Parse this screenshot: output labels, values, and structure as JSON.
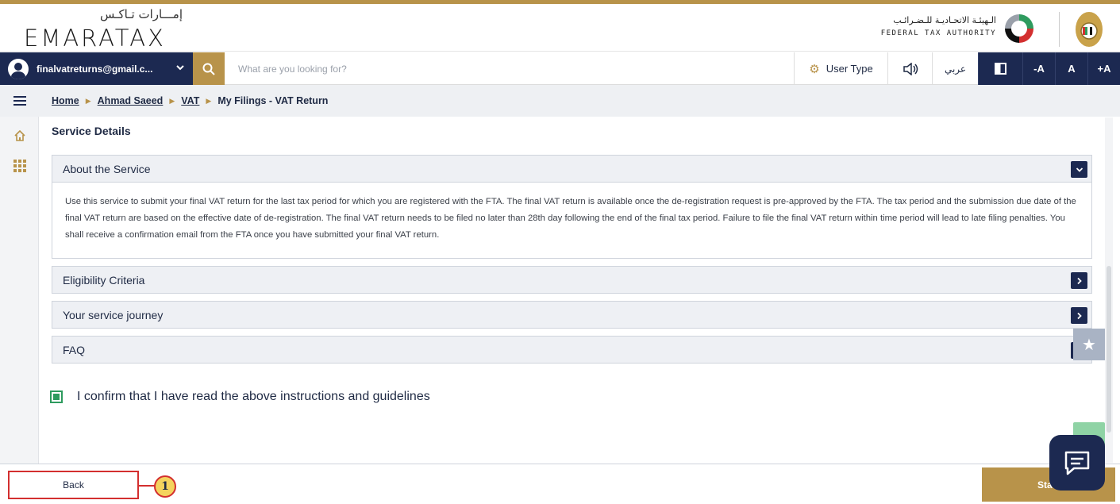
{
  "logo": {
    "ar": "إمـــارات تـاكـس",
    "en": "EMARATAX"
  },
  "authority": {
    "ar": "الـهيئـة الاتحـاديـة للـضـرائـب",
    "en": "FEDERAL TAX AUTHORITY"
  },
  "nav": {
    "user_email": "finalvatreturns@gmail.c...",
    "search_placeholder": "What are you looking for?",
    "user_type": "User Type",
    "language": "عربي",
    "font_decrease": "-A",
    "font_normal": "A",
    "font_increase": "+A"
  },
  "breadcrumb": {
    "home": "Home",
    "profile": "Ahmad Saeed",
    "vat": "VAT",
    "current": "My Filings - VAT Return"
  },
  "content": {
    "section_title": "Service Details",
    "accordions": [
      {
        "title": "About the Service",
        "expanded": true,
        "body": "Use this service to submit your final VAT return for the last tax period for which you are registered with the FTA. The final VAT return is available once the de-registration request is pre-approved by the FTA. The tax period and the submission due date of the final VAT return are based on the effective date of de-registration. The final VAT return needs to be filed no later than 28th day following the end of the final tax period. Failure to file the final VAT return within time period will lead to late filing penalties. You shall receive a confirmation email from the FTA once you have submitted your final VAT return."
      },
      {
        "title": "Eligibility Criteria",
        "expanded": false
      },
      {
        "title": "Your service journey",
        "expanded": false
      },
      {
        "title": "FAQ",
        "expanded": false
      }
    ],
    "confirm_label": "I confirm that I have read the above instructions and guidelines",
    "confirm_checked": true
  },
  "footer": {
    "back_label": "Back",
    "start_label": "Sta",
    "callout_number": "1"
  },
  "colors": {
    "navy": "#1c2951",
    "gold": "#b8934a",
    "green": "#2e9b5e",
    "callout_red": "#d32f2f"
  },
  "icons": [
    "user-avatar-icon",
    "chevron-down-icon",
    "search-icon",
    "gear-icon",
    "speaker-icon",
    "contrast-icon",
    "menu-icon",
    "home-icon",
    "apps-grid-icon",
    "star-icon",
    "chat-icon"
  ]
}
